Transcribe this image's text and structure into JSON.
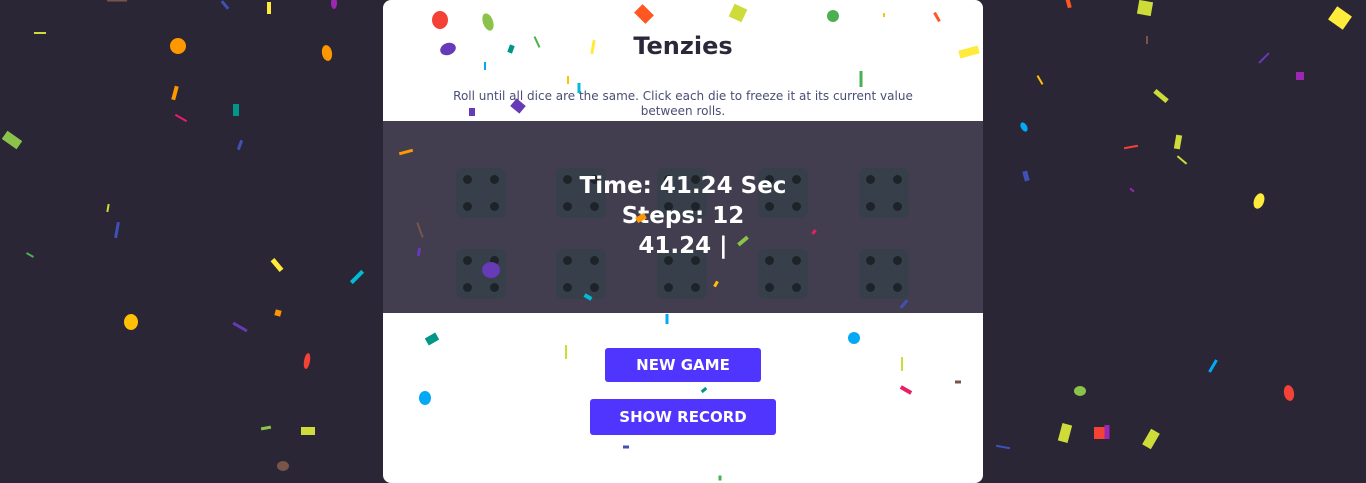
{
  "title": "Tenzies",
  "instructions": "Roll until all dice are the same. Click each die to freeze it at its current value between rolls.",
  "result": {
    "time": "Time: 41.24 Sec",
    "steps": "Steps: 12",
    "record": "41.24 |"
  },
  "dice": [
    {
      "value": 4
    },
    {
      "value": 4
    },
    {
      "value": 4
    },
    {
      "value": 4
    },
    {
      "value": 4
    },
    {
      "value": 4
    },
    {
      "value": 4
    },
    {
      "value": 4
    },
    {
      "value": 4
    },
    {
      "value": 4
    }
  ],
  "buttons": {
    "new_game": "NEW GAME",
    "show_record": "SHOW RECORD"
  },
  "colors": {
    "page_background": "#2a2636",
    "card": "#ffffff",
    "overlay": "#423d4f",
    "button": "#5035ff",
    "die": "#37404a"
  }
}
